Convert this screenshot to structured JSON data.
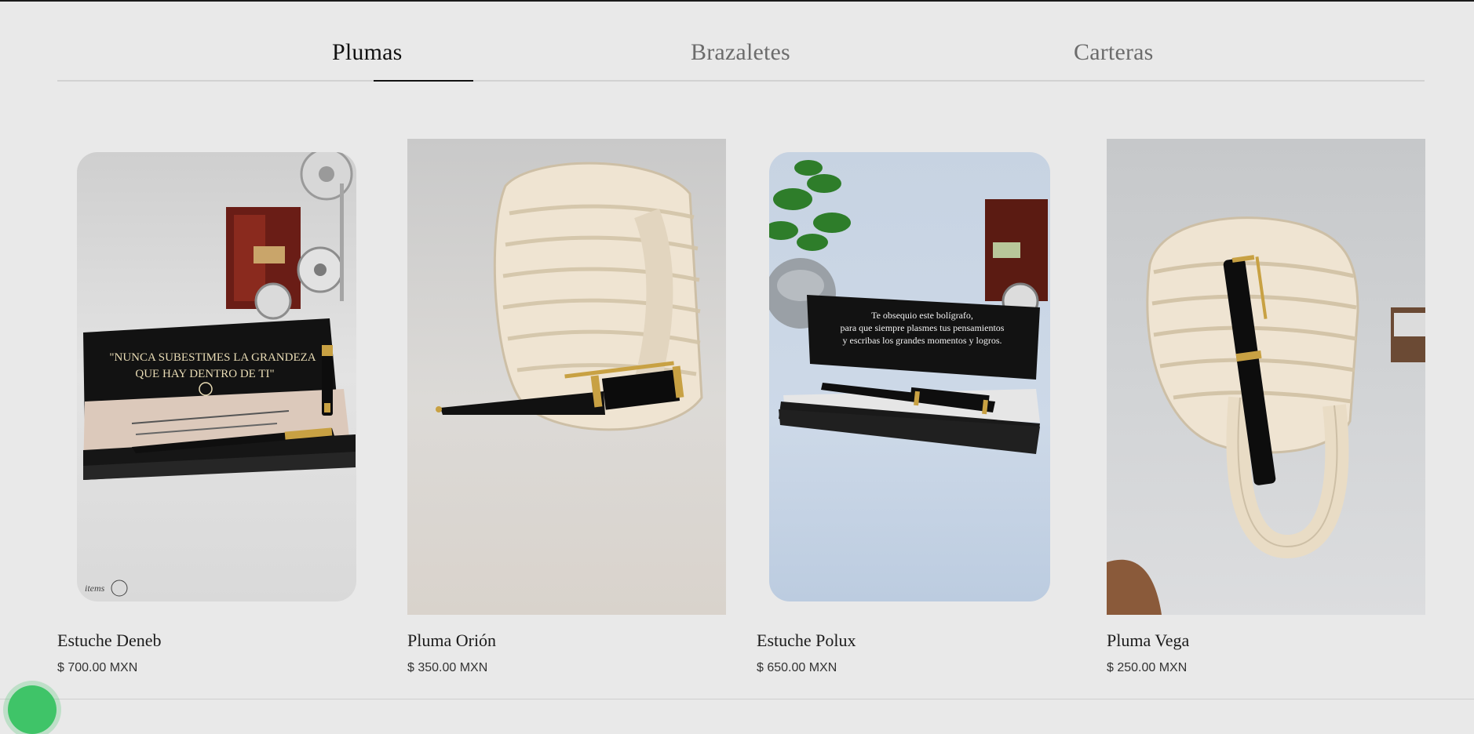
{
  "tabs": [
    {
      "label": "Plumas",
      "active": true
    },
    {
      "label": "Brazaletes",
      "active": false
    },
    {
      "label": "Carteras",
      "active": false
    }
  ],
  "products": [
    {
      "name": "Estuche Deneb",
      "price": "$ 700.00 MXN",
      "image_text": [
        "\"NUNCA SUBESTIMES LA GRANDEZA",
        "QUE HAY DENTRO DE TI\""
      ],
      "watermark": "items"
    },
    {
      "name": "Pluma Orión",
      "price": "$ 350.00 MXN"
    },
    {
      "name": "Estuche Polux",
      "price": "$ 650.00 MXN",
      "image_text": [
        "Te obsequio este bolígrafo,",
        "para que siempre plasmes tus pensamientos",
        "y escribas los grandes momentos y logros."
      ]
    },
    {
      "name": "Pluma Vega",
      "price": "$ 250.00 MXN"
    }
  ],
  "colors": {
    "background": "#e9e9e9",
    "whatsapp": "#3fc468",
    "active_tab": "#111111",
    "inactive_tab": "#6c6c6c"
  }
}
